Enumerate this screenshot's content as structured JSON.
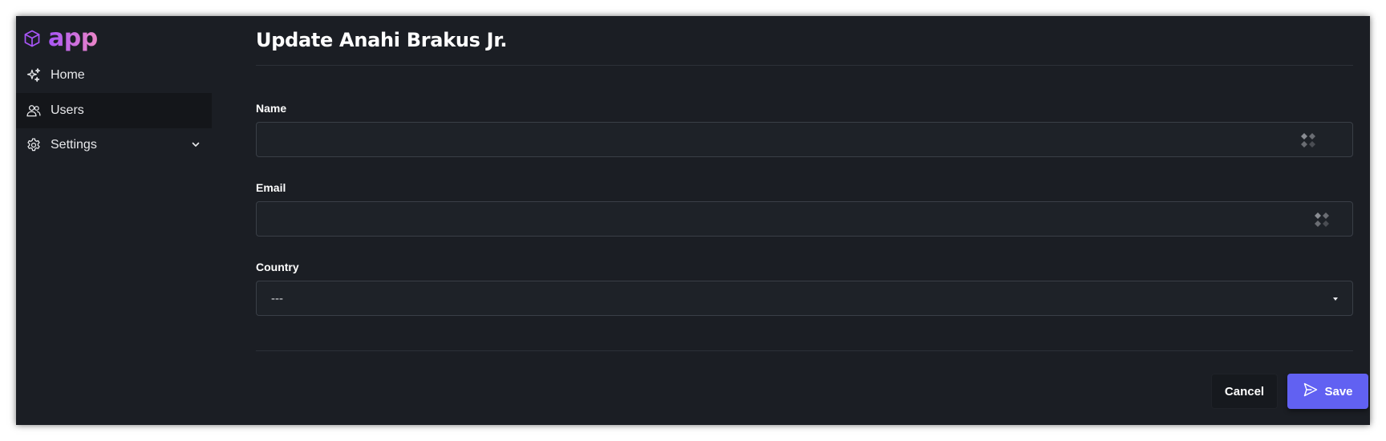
{
  "app": {
    "name": "app",
    "logo_icon": "cube-icon",
    "accent_gradient": [
      "#a855f7",
      "#ec86c7"
    ]
  },
  "sidebar": {
    "items": [
      {
        "label": "Home",
        "icon": "sparkles-icon",
        "active": false
      },
      {
        "label": "Users",
        "icon": "users-icon",
        "active": true
      },
      {
        "label": "Settings",
        "icon": "gear-icon",
        "active": false,
        "expandable": true,
        "expand_icon": "chevron-down-icon"
      }
    ]
  },
  "page": {
    "title": "Update Anahi Brakus Jr."
  },
  "form": {
    "name": {
      "label": "Name",
      "value": "",
      "placeholder": ""
    },
    "email": {
      "label": "Email",
      "value": "",
      "placeholder": ""
    },
    "country": {
      "label": "Country",
      "selected": "---"
    },
    "cancel_label": "Cancel",
    "save_label": "Save",
    "save_icon": "send-icon"
  },
  "colors": {
    "background": "#1b1e24",
    "primary_button": "#6161f2",
    "input_background": "#1e2228",
    "input_border": "#3a3f47"
  }
}
